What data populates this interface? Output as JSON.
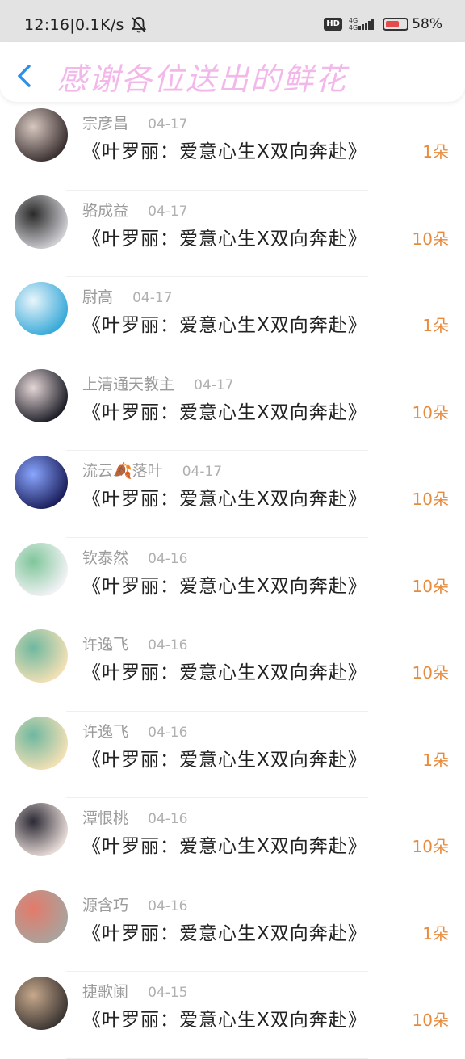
{
  "status": {
    "time_speed": "12:16|0.1K/s",
    "hd": "HD",
    "net_top": "4G",
    "net_bottom": "4G",
    "battery": "58%"
  },
  "header": {
    "title": "感谢各位送出的鲜花",
    "back_icon": "back-chevron-icon",
    "title_color": "#f3b8ea"
  },
  "accent_color": "#e88a3c",
  "items": [
    {
      "name": "宗彦昌",
      "date": "04-17",
      "title": "《叶罗丽：爱意心生X双向奔赴》",
      "amount": "1朵",
      "avatar_colors": [
        "#3a3030",
        "#d7c7c0"
      ]
    },
    {
      "name": "骆成益",
      "date": "04-17",
      "title": "《叶罗丽：爱意心生X双向奔赴》",
      "amount": "10朵",
      "avatar_colors": [
        "#cfcfd4",
        "#2a2a2a"
      ]
    },
    {
      "name": "尉高",
      "date": "04-17",
      "title": "《叶罗丽：爱意心生X双向奔赴》",
      "amount": "1朵",
      "avatar_colors": [
        "#38a9d8",
        "#e9f5fb"
      ]
    },
    {
      "name": "上清通天教主",
      "date": "04-17",
      "title": "《叶罗丽：爱意心生X双向奔赴》",
      "amount": "10朵",
      "avatar_colors": [
        "#1e1e28",
        "#e4d6d6"
      ]
    },
    {
      "name": "流云🍂落叶",
      "date": "04-17",
      "title": "《叶罗丽：爱意心生X双向奔赴》",
      "amount": "10朵",
      "avatar_colors": [
        "#1b1f5c",
        "#8aa6ff"
      ]
    },
    {
      "name": "钦泰然",
      "date": "04-16",
      "title": "《叶罗丽：爱意心生X双向奔赴》",
      "amount": "10朵",
      "avatar_colors": [
        "#f2f2f6",
        "#7fc69a"
      ]
    },
    {
      "name": "许逸飞",
      "date": "04-16",
      "title": "《叶罗丽：爱意心生X双向奔赴》",
      "amount": "10朵",
      "avatar_colors": [
        "#f3e0b5",
        "#6fb8a0"
      ]
    },
    {
      "name": "许逸飞",
      "date": "04-16",
      "title": "《叶罗丽：爱意心生X双向奔赴》",
      "amount": "1朵",
      "avatar_colors": [
        "#f3e0b5",
        "#6fb8a0"
      ]
    },
    {
      "name": "潭恨桃",
      "date": "04-16",
      "title": "《叶罗丽：爱意心生X双向奔赴》",
      "amount": "10朵",
      "avatar_colors": [
        "#e8dcd8",
        "#2c2a35"
      ]
    },
    {
      "name": "源含巧",
      "date": "04-16",
      "title": "《叶罗丽：爱意心生X双向奔赴》",
      "amount": "1朵",
      "avatar_colors": [
        "#a9a39d",
        "#e47a6a"
      ]
    },
    {
      "name": "捷歌阑",
      "date": "04-15",
      "title": "《叶罗丽：爱意心生X双向奔赴》",
      "amount": "10朵",
      "avatar_colors": [
        "#3b3532",
        "#c7a88c"
      ]
    }
  ]
}
